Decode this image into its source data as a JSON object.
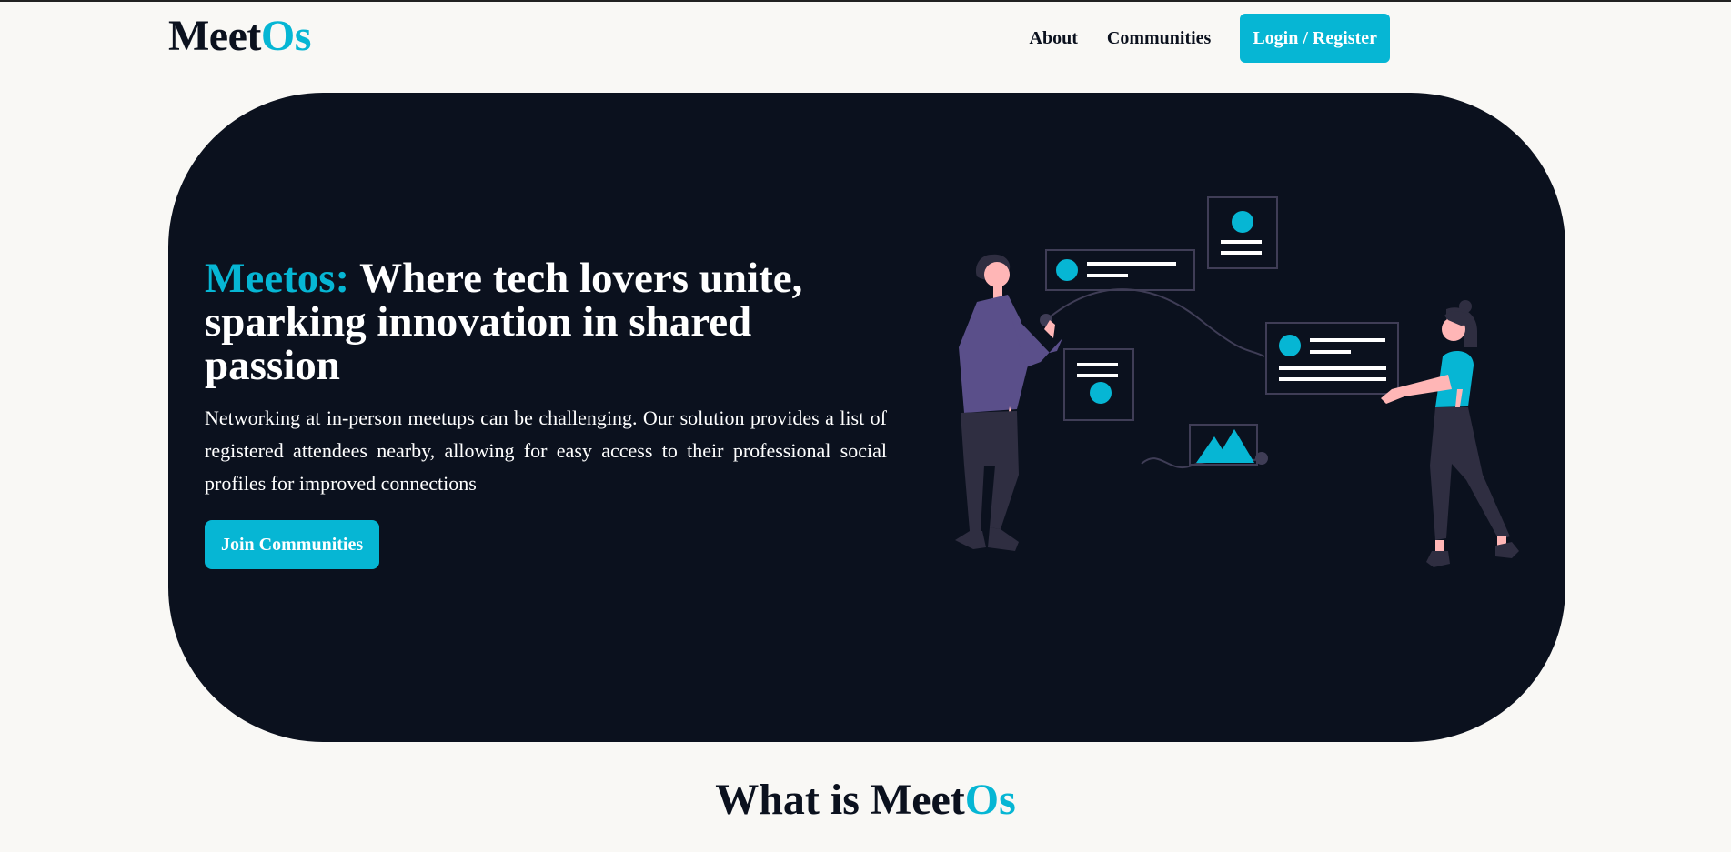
{
  "nav": {
    "logo_main": "Meet",
    "logo_accent": "Os",
    "links": [
      "About",
      "Communities"
    ],
    "login_label": "Login / Register"
  },
  "hero": {
    "title_accent": "Meetos:",
    "title_rest": " Where tech lovers unite, sparking innovation in shared passion",
    "description": "Networking at in-person meetups can be challenging. Our solution provides a list of registered attendees nearby, allowing for easy access to their professional social profiles for improved connections",
    "cta_label": "Join Communities"
  },
  "section": {
    "title_main": "What is Meet",
    "title_accent": "Os"
  },
  "colors": {
    "accent": "#06b6d4",
    "dark": "#0b111e",
    "background": "#f9f8f5"
  }
}
